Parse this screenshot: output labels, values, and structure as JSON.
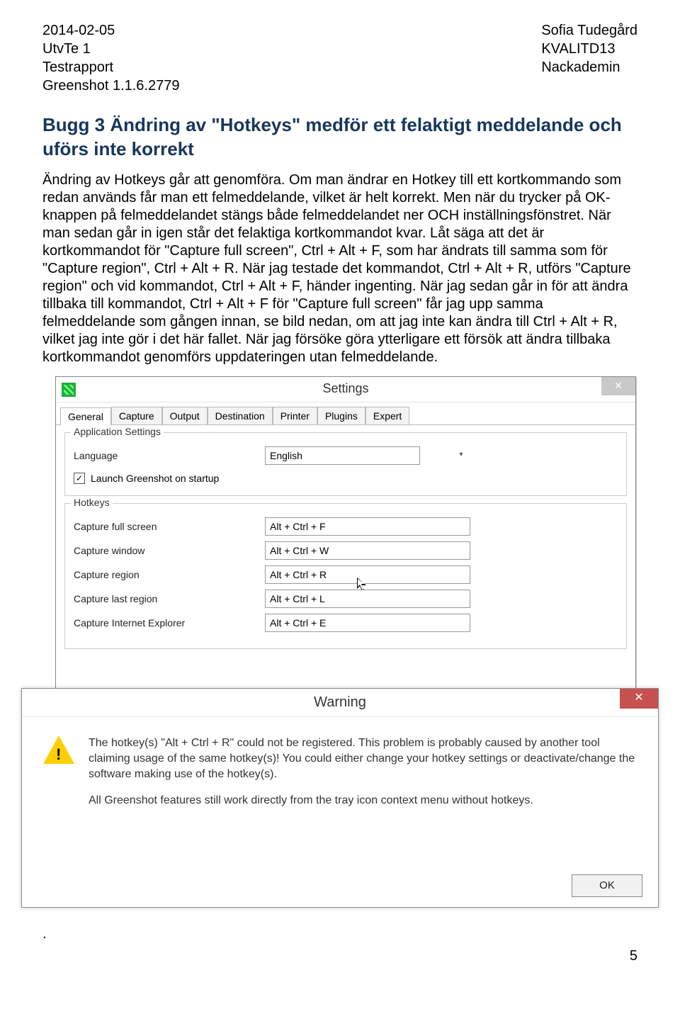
{
  "header": {
    "left": [
      "2014-02-05",
      "UtvTe 1",
      "Testrapport",
      "Greenshot 1.1.6.2779"
    ],
    "right": [
      "Sofia Tudegård",
      "KVALITD13",
      "Nackademin"
    ]
  },
  "bug_title": "Bugg 3 Ändring av \"Hotkeys\" medför ett felaktigt meddelande och uförs inte korrekt",
  "body": "Ändring av Hotkeys går att genomföra. Om man ändrar en Hotkey till ett kortkommando som redan används får man ett felmeddelande, vilket är helt korrekt. Men när du trycker på OK-knappen på felmeddelandet stängs både felmeddelandet ner OCH inställningsfönstret. När man sedan går in igen står det felaktiga kortkommandot kvar. Låt säga att det är kortkommandot för \"Capture full screen\", Ctrl + Alt + F, som har ändrats till samma som för \"Capture region\", Ctrl + Alt + R. När jag testade det kommandot, Ctrl + Alt + R, utförs \"Capture region\" och vid kommandot, Ctrl + Alt + F, händer ingenting. När jag sedan går in för att ändra tillbaka till kommandot, Ctrl + Alt + F för \"Capture full screen\" får jag upp samma felmeddelande som gången innan, se bild nedan, om att jag inte kan ändra till Ctrl + Alt + R, vilket jag inte gör i det här fallet. När jag försöke göra ytterligare ett försök att ändra tillbaka kortkommandot genomförs uppdateringen utan felmeddelande.",
  "settings": {
    "title": "Settings",
    "tabs": [
      "General",
      "Capture",
      "Output",
      "Destination",
      "Printer",
      "Plugins",
      "Expert"
    ],
    "active_tab": "General",
    "group_app": "Application Settings",
    "label_language": "Language",
    "language_value": "English",
    "chk_startup": "Launch Greenshot on startup",
    "chk_checked": true,
    "group_hotkeys": "Hotkeys",
    "rows": [
      {
        "label": "Capture full screen",
        "value": "Alt + Ctrl + F"
      },
      {
        "label": "Capture window",
        "value": "Alt + Ctrl + W"
      },
      {
        "label": "Capture region",
        "value": "Alt + Ctrl + R"
      },
      {
        "label": "Capture last region",
        "value": "Alt + Ctrl + L"
      },
      {
        "label": "Capture Internet Explorer",
        "value": "Alt + Ctrl + E"
      }
    ]
  },
  "warning": {
    "title": "Warning",
    "p1": "The hotkey(s) \"Alt + Ctrl + R\" could not be registered. This problem is probably caused by another tool claiming usage of the same hotkey(s)! You could either change your hotkey settings or deactivate/change the software making use of the hotkey(s).",
    "p2": "All Greenshot features still work directly from the tray icon context menu without hotkeys.",
    "ok": "OK"
  },
  "footer": {
    "dot": ".",
    "page": "5"
  },
  "icons": {
    "close": "✕",
    "check": "✓",
    "down": "▾"
  }
}
